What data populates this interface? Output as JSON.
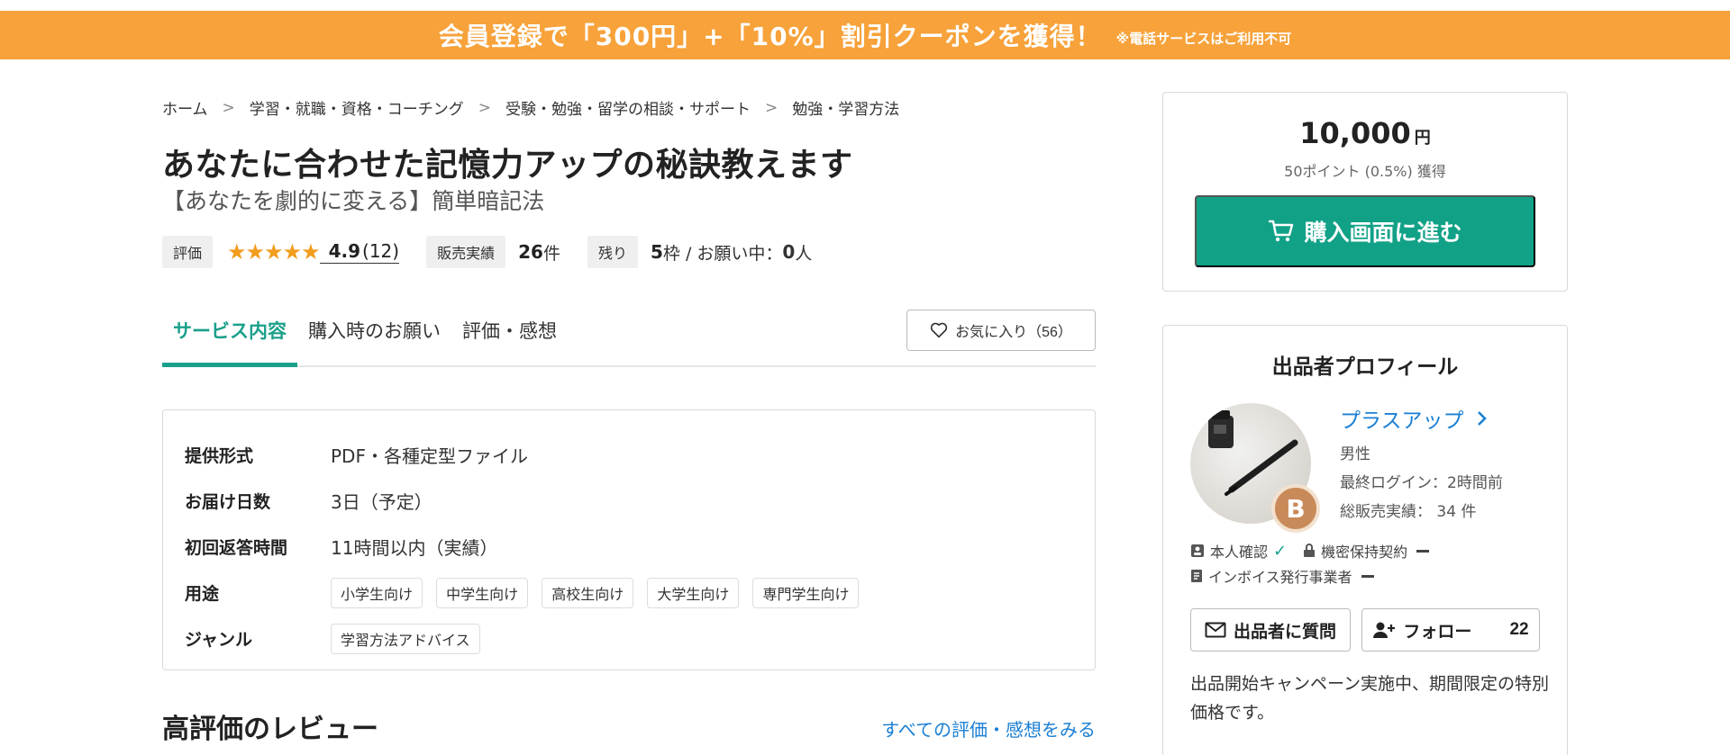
{
  "banner": {
    "main": "会員登録で「300円」+「10%」割引クーポンを獲得！",
    "note": "※電話サービスはご利用不可"
  },
  "breadcrumb": [
    "ホーム",
    "学習・就職・資格・コーチング",
    "受験・勉強・留学の相談・サポート",
    "勉強・学習方法"
  ],
  "breadcrumb_sep": ">",
  "service": {
    "title": "あなたに合わせた記憶力アップの秘訣教えます",
    "subtitle": "【あなたを劇的に変える】簡単暗記法"
  },
  "stats": {
    "rating_label": "評価",
    "stars": "★★★★★",
    "rating_value": "4.9",
    "rating_count": "(12)",
    "sales_label": "販売実績",
    "sales_value": "26",
    "sales_unit": "件",
    "remaining_label": "残り",
    "remaining_value": "5",
    "remaining_text": "枠 / お願い中：",
    "requests_value": "0",
    "requests_unit": "人"
  },
  "tabs": [
    "サービス内容",
    "購入時のお願い",
    "評価・感想"
  ],
  "favorite": {
    "label": "お気に入り（56）"
  },
  "info": {
    "rows": [
      {
        "label": "提供形式",
        "value": "PDF・各種定型ファイル"
      },
      {
        "label": "お届け日数",
        "value": "3日（予定）"
      },
      {
        "label": "初回返答時間",
        "value": "11時間以内（実績）"
      }
    ],
    "usage_label": "用途",
    "usage_tags": [
      "小学生向け",
      "中学生向け",
      "高校生向け",
      "大学生向け",
      "専門学生向け"
    ],
    "genre_label": "ジャンル",
    "genre_tags": [
      "学習方法アドバイス"
    ]
  },
  "reviews": {
    "title": "高評価のレビュー",
    "link": "すべての評価・感想をみる"
  },
  "price": {
    "amount": "10,000",
    "currency": "円",
    "points": "50ポイント (0.5%) 獲得",
    "buy_label": "購入画面に進む"
  },
  "profile": {
    "heading": "出品者プロフィール",
    "name": "プラスアップ",
    "badge": "B",
    "gender": "男性",
    "last_login": "最終ログイン：2時間前",
    "total_sales": "総販売実績： 34 件",
    "identity": "本人確認",
    "nda": "機密保持契約",
    "invoice": "インボイス発行事業者",
    "ask_label": "出品者に質問",
    "follow_label": "フォロー",
    "follow_count": "22",
    "description": "出品開始キャンペーン実施中、期間限定の特別価格です。"
  },
  "colors": {
    "banner": "#f7a23a",
    "accent": "#11a187",
    "link": "#1a7fd4",
    "star": "#f29d1d"
  }
}
